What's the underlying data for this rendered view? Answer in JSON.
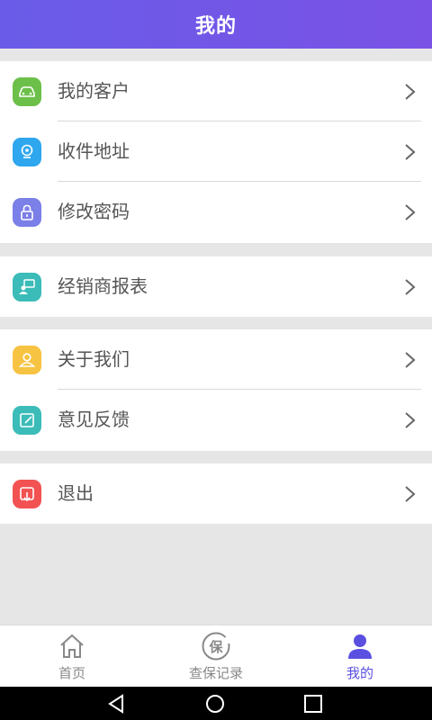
{
  "header": {
    "title": "我的"
  },
  "groups": [
    {
      "items": [
        {
          "label": "我的客户",
          "icon": "car-icon",
          "color": "#6cc04a"
        },
        {
          "label": "收件地址",
          "icon": "location-pin-icon",
          "color": "#2ea7ee"
        },
        {
          "label": "修改密码",
          "icon": "lock-icon",
          "color": "#7b7fe8"
        }
      ]
    },
    {
      "items": [
        {
          "label": "经销商报表",
          "icon": "dealer-report-icon",
          "color": "#3bbcb8"
        }
      ]
    },
    {
      "items": [
        {
          "label": "关于我们",
          "icon": "user-icon",
          "color": "#f7c342"
        },
        {
          "label": "意见反馈",
          "icon": "edit-icon",
          "color": "#3bbcb8"
        }
      ]
    },
    {
      "items": [
        {
          "label": "退出",
          "icon": "logout-icon",
          "color": "#f25252"
        }
      ]
    }
  ],
  "tabbar": {
    "tabs": [
      {
        "label": "首页",
        "icon": "home-icon",
        "active": false
      },
      {
        "label": "查保记录",
        "icon": "warranty-record-icon",
        "icon_text": "保",
        "active": false
      },
      {
        "label": "我的",
        "icon": "profile-icon",
        "active": true
      }
    ],
    "active_color": "#5a4fe0"
  },
  "colors": {
    "header_start": "#6a5ce8",
    "header_end": "#7a52e6",
    "background": "#e6e6e6"
  }
}
